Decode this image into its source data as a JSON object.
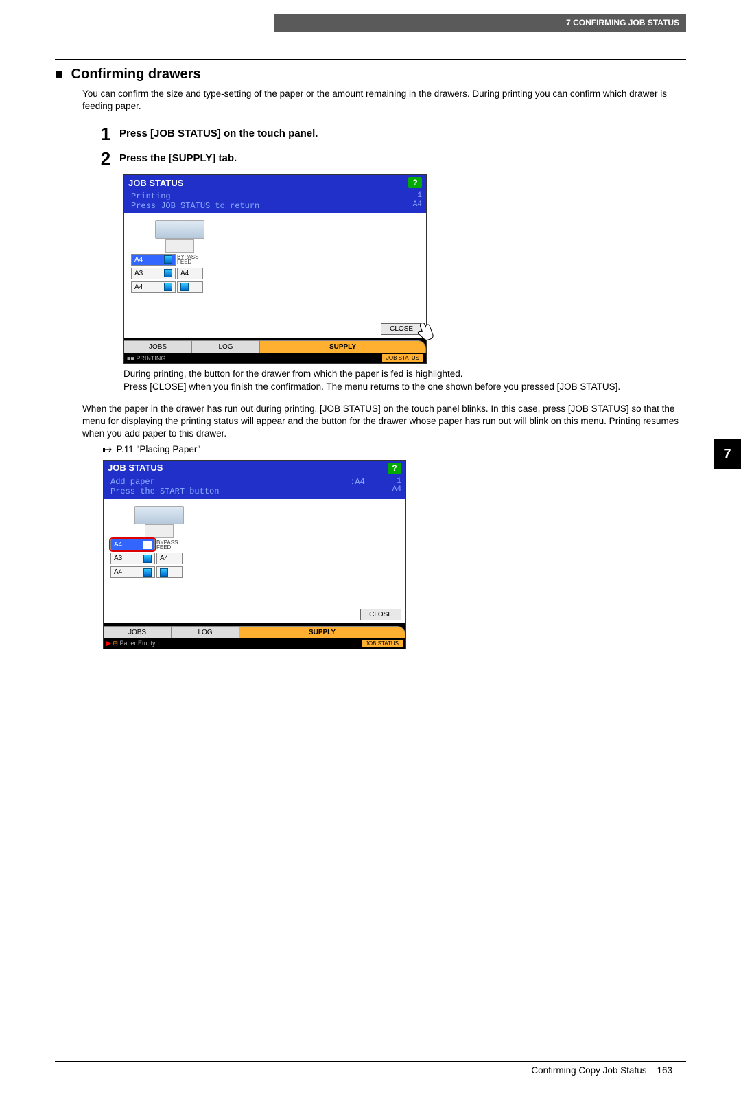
{
  "header": {
    "chapter_label": "7 CONFIRMING JOB STATUS"
  },
  "side_tab": "7",
  "section": {
    "title": "Confirming drawers",
    "intro": "You can confirm the size and type-setting of the paper or the amount remaining in the drawers. During printing you can confirm which drawer is feeding paper."
  },
  "steps": [
    {
      "num": "1",
      "text": "Press [JOB STATUS] on the touch panel."
    },
    {
      "num": "2",
      "text": "Press the [SUPPLY] tab."
    }
  ],
  "screenshot1": {
    "title": "JOB STATUS",
    "status_line1": "Printing",
    "status_line2": "Press JOB STATUS to return",
    "right_top": "1\nA4",
    "trays": {
      "bypass": "BYPASS\nFEED",
      "row1_size": "A4",
      "row2_size": "A3",
      "row2_right": "A4",
      "row3_size": "A4"
    },
    "close": "CLOSE",
    "tabs": {
      "jobs": "JOBS",
      "log": "LOG",
      "supply": "SUPPLY"
    },
    "footer_left": "■■  PRINTING",
    "footer_right": "JOB STATUS"
  },
  "note_after_ss1_a": "During printing, the button for the drawer from which the paper is fed is highlighted.",
  "note_after_ss1_b": "Press [CLOSE] when you finish the confirmation. The menu returns to the one shown before you pressed [JOB STATUS].",
  "body_note": "When the paper in the drawer has run out during printing, [JOB STATUS] on the touch panel blinks. In this case, press [JOB STATUS] so that the menu for displaying the printing status will appear and the button for the drawer whose paper has run out will blink on this menu. Printing resumes when you add paper to this drawer.",
  "ref_page": "P.11 \"Placing Paper\"",
  "screenshot2": {
    "title": "JOB STATUS",
    "status_line1": "Add paper",
    "status_line2": "Press the START button",
    "right_mid": ":A4",
    "right_top": "1\nA4",
    "trays": {
      "bypass": "BYPASS\nFEED",
      "row1_size": "A4",
      "row2_size": "A3",
      "row2_right": "A4",
      "row3_size": "A4"
    },
    "close": "CLOSE",
    "tabs": {
      "jobs": "JOBS",
      "log": "LOG",
      "supply": "SUPPLY"
    },
    "footer_left": "Paper Empty",
    "footer_right": "JOB STATUS"
  },
  "footer": {
    "section_name": "Confirming Copy Job Status",
    "page_number": "163"
  }
}
